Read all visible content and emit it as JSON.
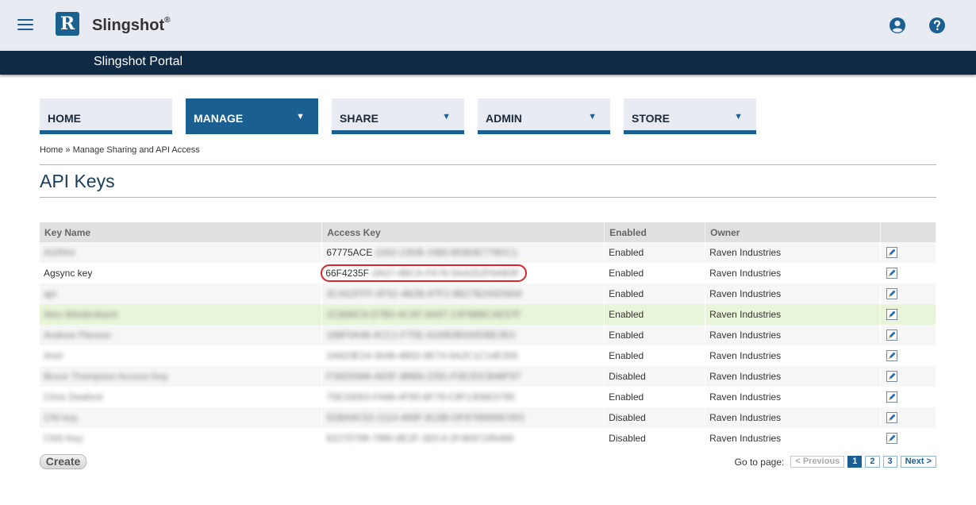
{
  "header": {
    "brand": "Slingshot",
    "brand_mark": "®",
    "logo_letter": "R",
    "portal_title": "Slingshot Portal",
    "colors": {
      "topbar": "#e8ebf2",
      "portalbar": "#0e2a44",
      "accent": "#1a5f91"
    }
  },
  "nav": {
    "tabs": [
      {
        "label": "HOME",
        "caret": ""
      },
      {
        "label": "MANAGE",
        "caret": "▼"
      },
      {
        "label": "SHARE",
        "caret": "▼"
      },
      {
        "label": "ADMIN",
        "caret": "▼"
      },
      {
        "label": "STORE",
        "caret": "▼"
      }
    ]
  },
  "breadcrumb": {
    "home": "Home",
    "sep": " » ",
    "current": "Manage Sharing and API Access"
  },
  "page": {
    "title": "API Keys"
  },
  "table": {
    "columns": [
      "Key Name",
      "Access Key",
      "Enabled",
      "Owner",
      ""
    ],
    "rows": [
      {
        "name": "AGRInt",
        "key_prefix": "67775ACE",
        "key_rest": "-1002-23DB-1980-BDB3E779DC1",
        "enabled": "Enabled",
        "owner": "Raven Industries"
      },
      {
        "name": "Agsync key",
        "key_prefix": "66F4235F",
        "key_rest": "-3A07-4BCA-FA76-5AA252F6AB3F",
        "enabled": "Enabled",
        "owner": "Raven Industries"
      },
      {
        "name": "api",
        "key_prefix": "",
        "key_rest": "3CA52FFF-0F52-4B2B-97F2-9B27B2A5D9A9",
        "enabled": "Enabled",
        "owner": "Raven Industries"
      },
      {
        "name": "Alex Wiedenbach",
        "key_prefix": "",
        "key_rest": "2CB86C9-D7B0-4CAF-8A97-13F6BBCAE57F",
        "enabled": "Enabled",
        "owner": "Raven Industries"
      },
      {
        "name": "Andrew Pierson",
        "key_prefix": "",
        "key_rest": "188F0A48-4CC1-F75E-8109DB0A0DBE3E0",
        "enabled": "Enabled",
        "owner": "Raven Industries"
      },
      {
        "name": "Ariel",
        "key_prefix": "",
        "key_rest": "2A623E24-3048-4B02-8E74-5A2C1C14E300",
        "enabled": "Enabled",
        "owner": "Raven Industries"
      },
      {
        "name": "Bruce Thompson Access Key",
        "key_prefix": "",
        "key_rest": "F30D5998-A63F-9BB8-2291-F0E2DCB48F97",
        "enabled": "Disabled",
        "owner": "Raven Industries"
      },
      {
        "name": "Chris Deaford",
        "key_prefix": "",
        "key_rest": "75E33063-FA66-4F90-8F79-C9F1306E0795",
        "enabled": "Enabled",
        "owner": "Raven Industries"
      },
      {
        "name": "CNI key",
        "key_prefix": "",
        "key_rest": "5DBA9C52-2114-469F-B19B-DF8789999C001",
        "enabled": "Disabled",
        "owner": "Raven Industries"
      },
      {
        "name": "CNS Key",
        "key_prefix": "",
        "key_rest": "62270799-7990-8E2F-3DC4-2F4697195466",
        "enabled": "Disabled",
        "owner": "Raven Industries"
      }
    ]
  },
  "actions": {
    "create_label": "Create"
  },
  "pager": {
    "goto_label": "Go to page:",
    "prev_label": "< Previous",
    "pages": [
      "1",
      "2",
      "3"
    ],
    "current_page": "1",
    "next_label": "Next >"
  }
}
